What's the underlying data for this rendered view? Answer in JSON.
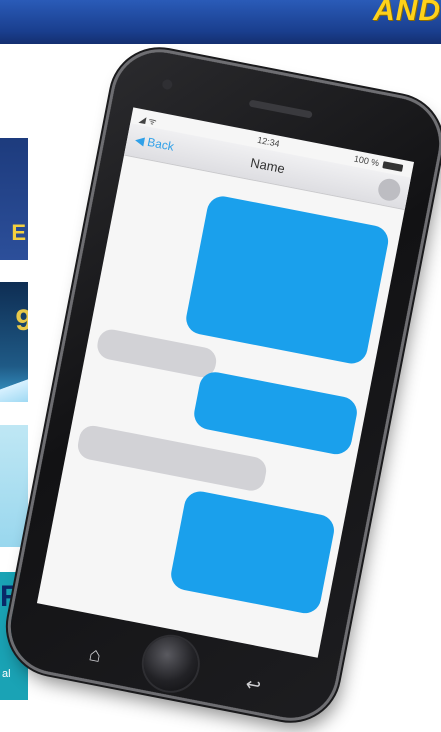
{
  "banner": {
    "text": "AND"
  },
  "cards": {
    "card1": {
      "glyph": "E"
    },
    "card2": {
      "glyph": "9"
    },
    "card4": {
      "glyph": "R",
      "small": "al"
    }
  },
  "phone": {
    "status": {
      "signal": "◢ ᯤ",
      "time": "12:34",
      "battery": "100 %"
    },
    "nav": {
      "back": "◀ Back",
      "title": "Name"
    },
    "nav_icons": {
      "home": "home-icon",
      "back": "back-arrow-icon"
    },
    "colors": {
      "sent_bubble": "#1aa0ec",
      "received_bubble": "#d2d2d6",
      "accent": "#2fa0e8"
    }
  }
}
